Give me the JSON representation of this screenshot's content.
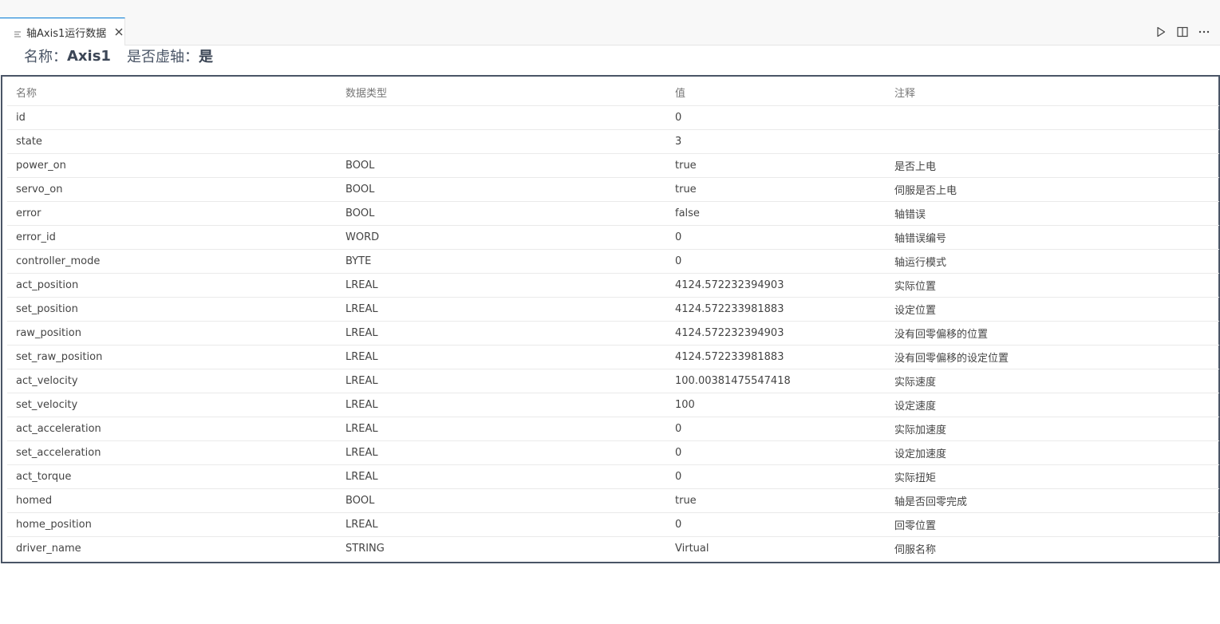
{
  "tab": {
    "label": "轴Axis1运行数据",
    "icon": "file-lines-icon"
  },
  "actions": [
    "play-icon",
    "split-editor-icon",
    "more-icon"
  ],
  "info": {
    "name_label": "名称：",
    "name_value": "Axis1",
    "virtual_label": "是否虚轴：",
    "virtual_value": "是"
  },
  "table": {
    "headers": [
      "名称",
      "数据类型",
      "值",
      "注释"
    ],
    "rows": [
      [
        "id",
        "",
        "0",
        ""
      ],
      [
        "state",
        "",
        "3",
        ""
      ],
      [
        "power_on",
        "BOOL",
        "true",
        "是否上电"
      ],
      [
        "servo_on",
        "BOOL",
        "true",
        "伺服是否上电"
      ],
      [
        "error",
        "BOOL",
        "false",
        "轴错误"
      ],
      [
        "error_id",
        "WORD",
        "0",
        "轴错误编号"
      ],
      [
        "controller_mode",
        "BYTE",
        "0",
        "轴运行模式"
      ],
      [
        "act_position",
        "LREAL",
        "4124.572232394903",
        "实际位置"
      ],
      [
        "set_position",
        "LREAL",
        "4124.572233981883",
        "设定位置"
      ],
      [
        "raw_position",
        "LREAL",
        "4124.572232394903",
        "没有回零偏移的位置"
      ],
      [
        "set_raw_position",
        "LREAL",
        "4124.572233981883",
        "没有回零偏移的设定位置"
      ],
      [
        "act_velocity",
        "LREAL",
        "100.00381475547418",
        "实际速度"
      ],
      [
        "set_velocity",
        "LREAL",
        "100",
        "设定速度"
      ],
      [
        "act_acceleration",
        "LREAL",
        "0",
        "实际加速度"
      ],
      [
        "set_acceleration",
        "LREAL",
        "0",
        "设定加速度"
      ],
      [
        "act_torque",
        "LREAL",
        "0",
        "实际扭矩"
      ],
      [
        "homed",
        "BOOL",
        "true",
        "轴是否回零完成"
      ],
      [
        "home_position",
        "LREAL",
        "0",
        "回零位置"
      ],
      [
        "driver_name",
        "STRING",
        "Virtual",
        "伺服名称"
      ]
    ]
  },
  "colors": {
    "accent": "#0078d4",
    "frame": "#4a5566",
    "header_text": "#777777"
  }
}
